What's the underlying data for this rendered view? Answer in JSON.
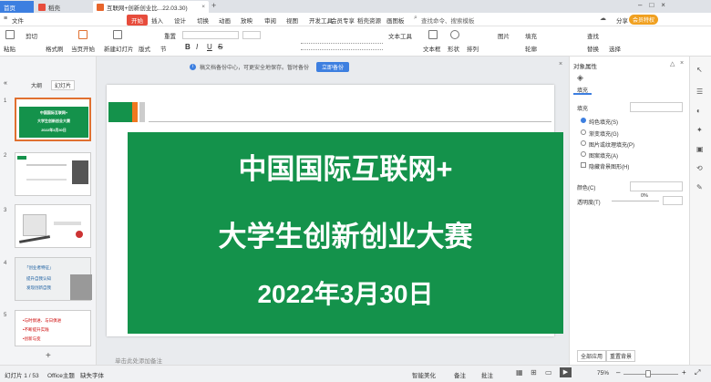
{
  "titlebar": {
    "home_tab": "首页",
    "wps_tab": "稻壳",
    "doc_tab": "互联网+创新创业比...22.03.30)",
    "add_tab": "+"
  },
  "menubar": {
    "file": "文件",
    "start": "开始",
    "items": [
      "插入",
      "设计",
      "切换",
      "动画",
      "放映",
      "审阅",
      "视图",
      "开发工具",
      "会员专享",
      "稻壳资源",
      "画图板"
    ],
    "search": "查找命令、搜索模板",
    "share": "分享",
    "upgrade": "会员特权"
  },
  "ribbon": {
    "cut": "剪切",
    "paste": "粘贴",
    "format_painter": "格式刷",
    "from_start": "当页开始",
    "new_slide": "新建幻灯片",
    "layout": "版式",
    "reset": "重置",
    "section": "节",
    "bold": "B",
    "italic": "I",
    "underline": "U",
    "strike": "S",
    "text_box": "文本框",
    "shape": "形状",
    "arrange": "排列",
    "picture": "图片",
    "fill": "填充",
    "outline": "轮廓",
    "find": "查找",
    "replace": "替换",
    "select": "选择",
    "textool": "文本工具"
  },
  "leftpanel": {
    "tab_outline": "大纲",
    "tab_slides": "幻灯片",
    "slide_numbers": [
      "1",
      "2",
      "3",
      "4",
      "5"
    ],
    "thumb1": {
      "line1": "中国国际互联网+",
      "line2": "大学生创新创业大赛",
      "line3": "2022年3月30日"
    },
    "thumb4": {
      "line1": "「创业者特征」",
      "line2": "提升自我认知",
      "line3": "发现创新自我"
    },
    "thumb5": {
      "line1": "•与时俱进、与日俱进",
      "line2": "•不断提升实践",
      "line3": "•创新与变"
    },
    "add": "+"
  },
  "notice": {
    "text": "稿文档备份中心，可更安全地保存。暂时备份",
    "button": "立即备份"
  },
  "slide": {
    "line1": "中国国际互联网+",
    "line2": "大学生创新创业大赛",
    "line3": "2022年3月30日",
    "notes": "单击此处添加备注"
  },
  "rightpanel": {
    "title": "对象属性",
    "tab": "填充",
    "section": "填充",
    "options": [
      "纯色填充(S)",
      "渐变填充(G)",
      "图片或纹理填充(P)",
      "图案填充(A)"
    ],
    "hide_bg": "隐藏背景图形(H)",
    "color_label": "颜色(C)",
    "transparency_label": "透明度(T)",
    "transparency_value": "0%",
    "apply_all": "全部应用",
    "reset_bg": "重置背景"
  },
  "statusbar": {
    "slide_info": "幻灯片 1 / 53",
    "theme": "Office主题",
    "font_missing": "缺失字体",
    "beautify": "智能美化",
    "notes": "备注",
    "comments": "批注",
    "zoom": "75%"
  }
}
